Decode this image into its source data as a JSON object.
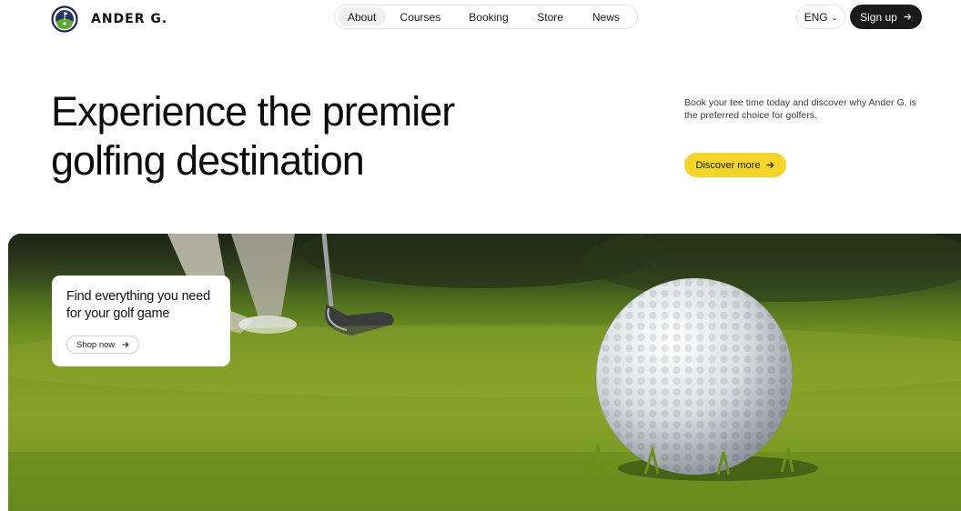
{
  "brand": {
    "name": "ANDER G."
  },
  "nav": {
    "items": [
      {
        "label": "About",
        "active": true
      },
      {
        "label": "Courses"
      },
      {
        "label": "Booking"
      },
      {
        "label": "Store"
      },
      {
        "label": "News"
      }
    ]
  },
  "header": {
    "language": "ENG",
    "signup_label": "Sign up",
    "icons": {
      "language": "chevron-down-icon",
      "signup": "arrow-right-icon"
    }
  },
  "hero": {
    "title_line1": "Experience the premier",
    "title_line2": "golfing destination",
    "description": "Book your tee time today and discover why Ander G. is the preferred choice for golfers.",
    "cta_label": "Discover more"
  },
  "promo": {
    "title": "Find everything you need for your golf game",
    "cta_label": "Shop now"
  },
  "colors": {
    "accent_yellow": "#f6d52b",
    "dark": "#1a1a1a",
    "grass": "#7d9b24"
  }
}
